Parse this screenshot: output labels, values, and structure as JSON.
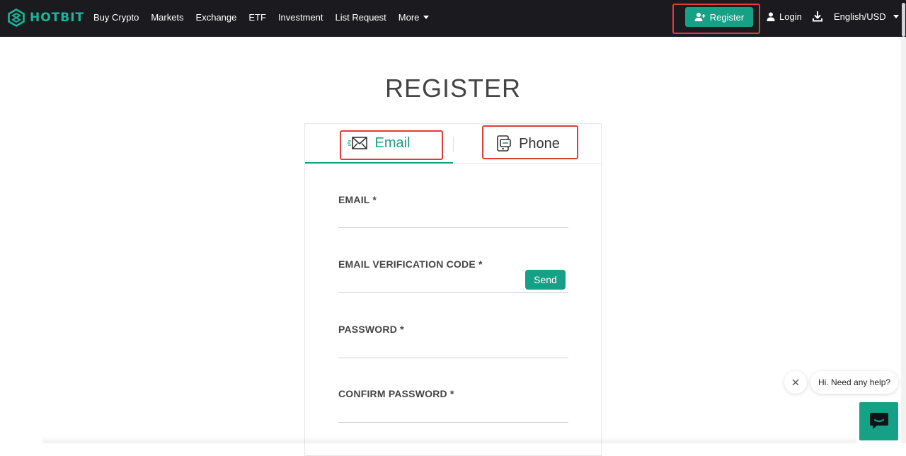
{
  "brand": {
    "name": "HOTBIT",
    "accent": "#16a085",
    "logo_text_color": "#18b79a"
  },
  "nav": {
    "items": [
      "Buy Crypto",
      "Markets",
      "Exchange",
      "ETF",
      "Investment",
      "List Request"
    ],
    "more_label": "More"
  },
  "header_right": {
    "register_label": "Register",
    "login_label": "Login",
    "language_label": "English/USD"
  },
  "page": {
    "title": "REGISTER"
  },
  "tabs": {
    "email_label": "Email",
    "phone_label": "Phone",
    "active": "Email"
  },
  "form": {
    "email_label": "EMAIL *",
    "email_value": "",
    "code_label": "EMAIL VERIFICATION CODE *",
    "code_value": "",
    "send_label": "Send",
    "password_label": "PASSWORD *",
    "password_value": "",
    "confirm_label": "CONFIRM PASSWORD *",
    "confirm_value": ""
  },
  "help": {
    "bubble_text": "Hi. Need any help?"
  },
  "colors": {
    "topbar": "#1b1b1f",
    "highlight": "#e23b3b"
  }
}
